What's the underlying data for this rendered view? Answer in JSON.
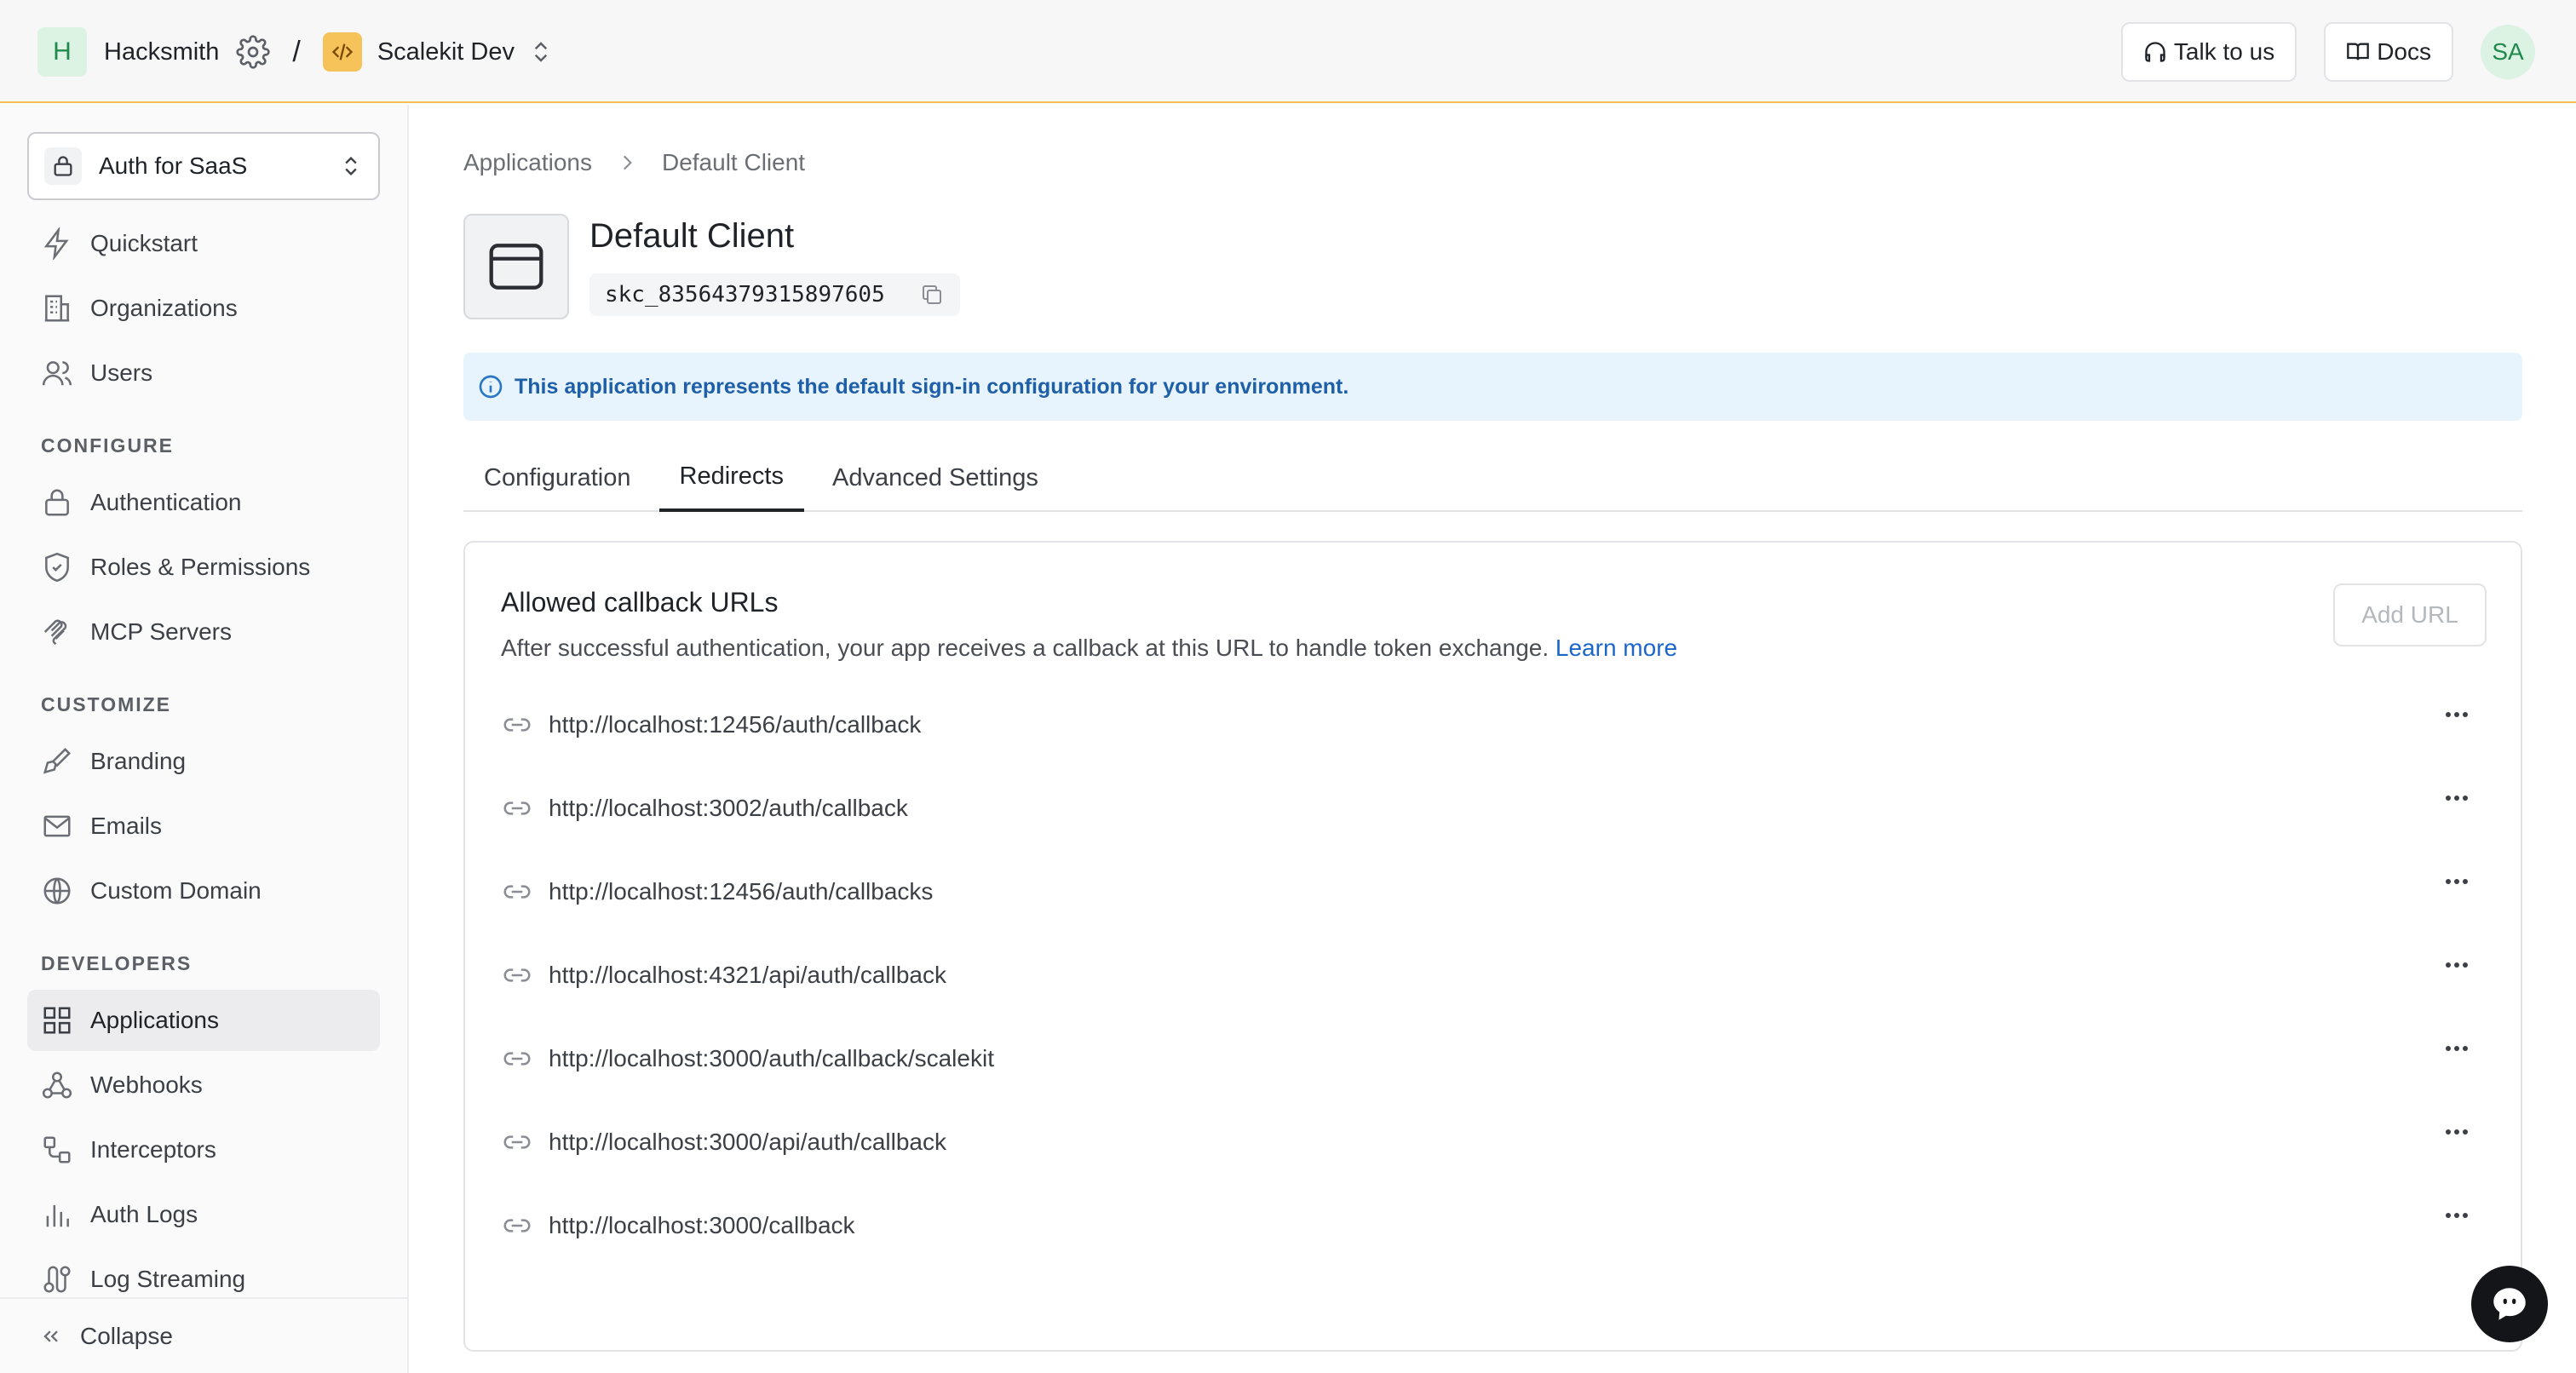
{
  "topbar": {
    "workspace_initial": "H",
    "workspace_name": "Hacksmith",
    "separator": "/",
    "environment_name": "Scalekit Dev",
    "talk_label": "Talk to us",
    "docs_label": "Docs",
    "user_initials": "SA"
  },
  "sidebar": {
    "product_selector": "Auth for SaaS",
    "top_items": [
      {
        "label": "Quickstart",
        "icon": "bolt-icon"
      },
      {
        "label": "Organizations",
        "icon": "building-icon"
      },
      {
        "label": "Users",
        "icon": "users-icon"
      }
    ],
    "sections": [
      {
        "heading": "CONFIGURE",
        "items": [
          {
            "label": "Authentication",
            "icon": "lock-icon"
          },
          {
            "label": "Roles & Permissions",
            "icon": "shield-icon"
          },
          {
            "label": "MCP Servers",
            "icon": "mcp-icon"
          }
        ]
      },
      {
        "heading": "CUSTOMIZE",
        "items": [
          {
            "label": "Branding",
            "icon": "paintbrush-icon"
          },
          {
            "label": "Emails",
            "icon": "mail-icon"
          },
          {
            "label": "Custom Domain",
            "icon": "globe-icon"
          }
        ]
      },
      {
        "heading": "DEVELOPERS",
        "items": [
          {
            "label": "Applications",
            "icon": "grid-icon",
            "active": true
          },
          {
            "label": "Webhooks",
            "icon": "webhook-icon"
          },
          {
            "label": "Interceptors",
            "icon": "interceptor-icon"
          },
          {
            "label": "Auth Logs",
            "icon": "bar-chart-icon"
          },
          {
            "label": "Log Streaming",
            "icon": "stream-icon"
          }
        ]
      }
    ],
    "collapse_label": "Collapse"
  },
  "main": {
    "breadcrumb": [
      "Applications",
      "Default Client"
    ],
    "app_title": "Default Client",
    "client_id": "skc_83564379315897605",
    "info_banner": "This application represents the default sign-in configuration for your environment.",
    "tabs": [
      {
        "label": "Configuration",
        "active": false
      },
      {
        "label": "Redirects",
        "active": true
      },
      {
        "label": "Advanced Settings",
        "active": false
      }
    ],
    "card": {
      "title": "Allowed callback URLs",
      "description": "After successful authentication, your app receives a callback at this URL to handle token exchange.",
      "learn_more": "Learn more",
      "add_button": "Add URL",
      "urls": [
        "http://localhost:12456/auth/callback",
        "http://localhost:3002/auth/callback",
        "http://localhost:12456/auth/callbacks",
        "http://localhost:4321/api/auth/callback",
        "http://localhost:3000/auth/callback/scalekit",
        "http://localhost:3000/api/auth/callback",
        "http://localhost:3000/callback"
      ]
    }
  },
  "colors": {
    "accent_border": "#f2c14e",
    "link": "#1c66c9",
    "info_bg": "#e7f4fd",
    "info_text": "#1e5fa8"
  }
}
